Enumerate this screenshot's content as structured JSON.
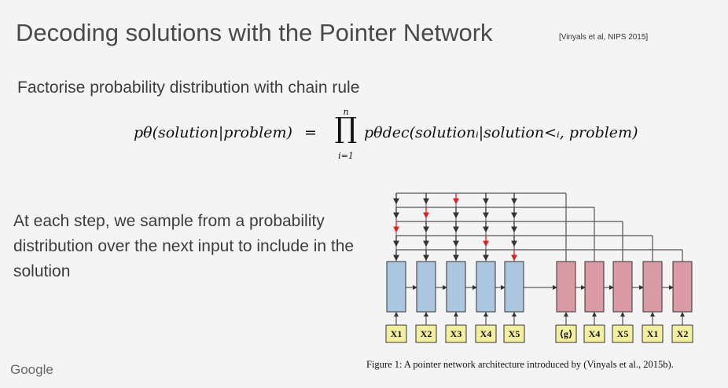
{
  "slide": {
    "title": "Decoding solutions with the Pointer Network",
    "citation": "[Vinyals et al, NIPS 2015]",
    "subtitle": "Factorise probability distribution with chain rule",
    "body": "At each step, we sample from a probability distribution over the next input to include in the solution",
    "logo": "Google"
  },
  "formula": {
    "lhs": "pθ(solution|problem)",
    "eq": "=",
    "prod": "∏",
    "upper": "n",
    "lower": "i=1",
    "rhs": "pθdec(solutionᵢ|solution<ᵢ, problem)"
  },
  "figure": {
    "encoder_inputs": [
      "X1",
      "X2",
      "X3",
      "X4",
      "X5"
    ],
    "decoder_inputs": [
      "⟨g⟩",
      "X4",
      "X5",
      "X1",
      "X2"
    ],
    "caption": "Figure 1: A pointer network architecture introduced by (Vinyals et al., 2015b).",
    "colors": {
      "encoder": "#adc6e0",
      "decoder": "#d99aa3",
      "input_box": "#f2ef9e",
      "pointer": "#e02020"
    }
  }
}
